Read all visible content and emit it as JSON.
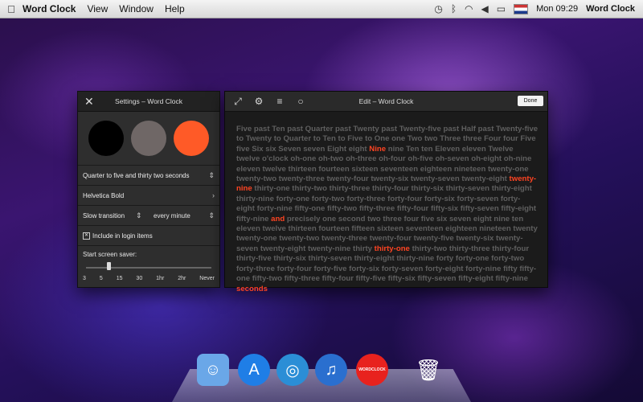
{
  "menubar": {
    "apple_icon": "apple-icon",
    "app_name": "Word Clock",
    "menus": [
      "View",
      "Window",
      "Help"
    ],
    "clock": "Mon 09:29",
    "app_name_right": "Word Clock"
  },
  "settings": {
    "title": "Settings – Word Clock",
    "swatches": [
      "#000000",
      "#6f6766",
      "#ff5a27"
    ],
    "rows": {
      "style": "Quarter to five and thirty two seconds",
      "font": "Helvetica Bold",
      "transition": "Slow transition",
      "frequency": "every minute",
      "login_label": "Include in login items"
    },
    "screen_saver_label": "Start screen saver:",
    "ticks": [
      "3",
      "5",
      "15",
      "30",
      "1hr",
      "2hr",
      "Never"
    ],
    "selected_tick": "5"
  },
  "edit": {
    "title": "Edit – Word Clock",
    "done_label": "Done",
    "tools": [
      "fullscreen-icon",
      "gear-icon",
      "list-icon",
      "circle-icon"
    ],
    "text_segments": [
      {
        "t": "Five past Ten past Quarter past Twenty past Twenty-five past Half past Twenty-five to Twenty to Quarter to Ten to Five to One one Two two Three three Four four Five five Six six Seven seven Eight eight ",
        "hl": false
      },
      {
        "t": "Nine",
        "hl": true
      },
      {
        "t": " nine Ten ten Eleven eleven Twelve twelve o'clock oh-one oh-two oh-three oh-four oh-five oh-seven oh-eight oh-nine eleven twelve thirteen fourteen sixteen seventeen eighteen nineteen twenty-one twenty-two twenty-three twenty-four twenty-six twenty-seven twenty-eight ",
        "hl": false
      },
      {
        "t": "twenty-nine",
        "hl": true
      },
      {
        "t": " thirty-one thirty-two thirty-three thirty-four thirty-six thirty-seven thirty-eight thirty-nine forty-one forty-two forty-three forty-four forty-six forty-seven forty-eight forty-nine fifty-one fifty-two fifty-three fifty-four fifty-six fifty-seven fifty-eight fifty-nine ",
        "hl": false
      },
      {
        "t": "and",
        "hl": true
      },
      {
        "t": " precisely one second two three four five six seven eight nine ten eleven twelve thirteen fourteen fifteen sixteen seventeen eighteen nineteen twenty twenty-one twenty-two twenty-three twenty-four twenty-five twenty-six twenty-seven twenty-eight twenty-nine thirty ",
        "hl": false
      },
      {
        "t": "thirty-one",
        "hl": true
      },
      {
        "t": " thirty-two thirty-three thirty-four thirty-five thirty-six thirty-seven thirty-eight thirty-nine forty forty-one forty-two forty-three forty-four forty-five forty-six forty-seven forty-eight forty-nine fifty fifty-one fifty-two fifty-three fifty-four fifty-five fifty-six fifty-seven fifty-eight fifty-nine ",
        "hl": false
      },
      {
        "t": "seconds",
        "hl": true
      }
    ]
  },
  "dock": {
    "items": [
      {
        "name": "finder",
        "color": "#6aa7e8",
        "glyph": "☺"
      },
      {
        "name": "app-store",
        "color": "#1f7ee6",
        "glyph": "A"
      },
      {
        "name": "safari",
        "color": "#2b8ed6",
        "glyph": "◎"
      },
      {
        "name": "itunes",
        "color": "#2a6fcf",
        "glyph": "♫"
      },
      {
        "name": "word-clock",
        "color": "#e8221e",
        "glyph": "WORDCLOCK"
      },
      {
        "name": "trash",
        "color": "#7d7d85",
        "glyph": "🗑"
      }
    ]
  }
}
